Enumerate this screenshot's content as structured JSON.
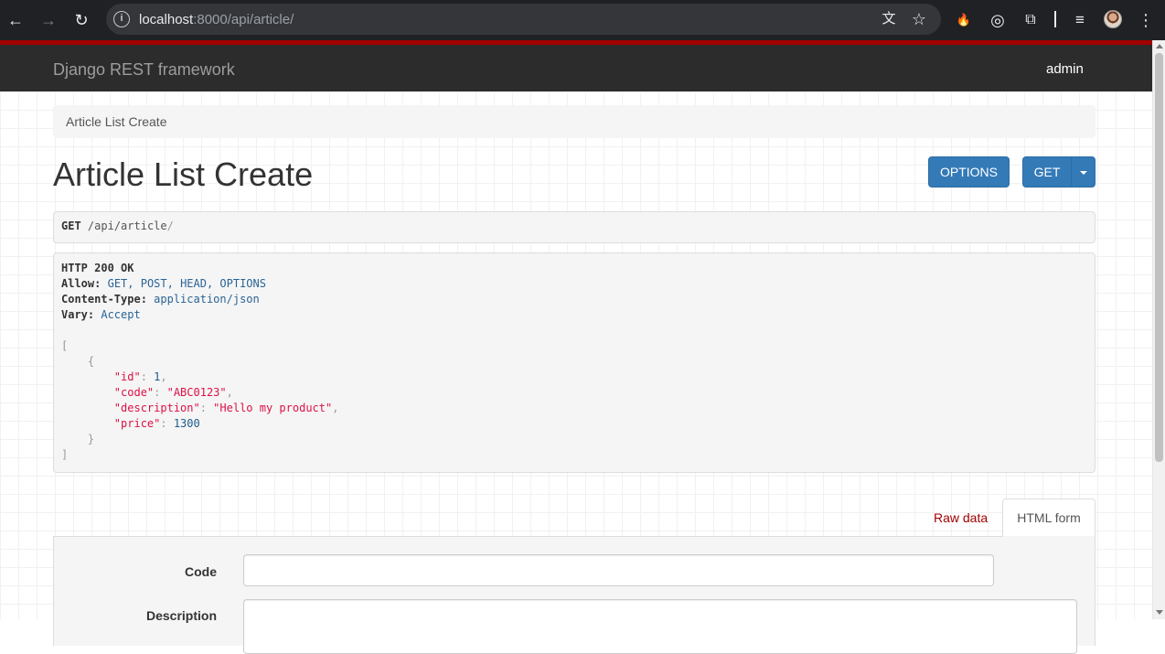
{
  "browser": {
    "back_icon": "←",
    "forward_icon": "→",
    "reload_icon": "↻",
    "url_host": "localhost",
    "url_rest": ":8000/api/article/",
    "translate_icon": "文",
    "star_icon": "☆",
    "extension_1_icon": "🔥",
    "extension_2_icon": "◎",
    "extensions_icon": "⧉",
    "media_icon": "≡",
    "menu_icon": "⋮"
  },
  "navbar": {
    "brand": "Django REST framework",
    "user": "admin"
  },
  "breadcrumb": "Article List Create",
  "page_title": "Article List Create",
  "buttons": {
    "options": "OPTIONS",
    "get": "GET"
  },
  "request": {
    "method": "GET",
    "path": "/api/article",
    "trailing_slash": "/"
  },
  "response": {
    "status": "HTTP 200 OK",
    "headers": [
      {
        "name": "Allow:",
        "value": "GET, POST, HEAD, OPTIONS"
      },
      {
        "name": "Content-Type:",
        "value": "application/json"
      },
      {
        "name": "Vary:",
        "value": "Accept"
      }
    ],
    "body": {
      "id": "1",
      "code": "\"ABC0123\"",
      "description": "\"Hello my product\"",
      "price": "1300"
    },
    "keys": {
      "id": "\"id\"",
      "code": "\"code\"",
      "description": "\"description\"",
      "price": "\"price\""
    }
  },
  "tabs": {
    "raw": "Raw data",
    "html": "HTML form"
  },
  "form": {
    "code_label": "Code",
    "description_label": "Description"
  }
}
